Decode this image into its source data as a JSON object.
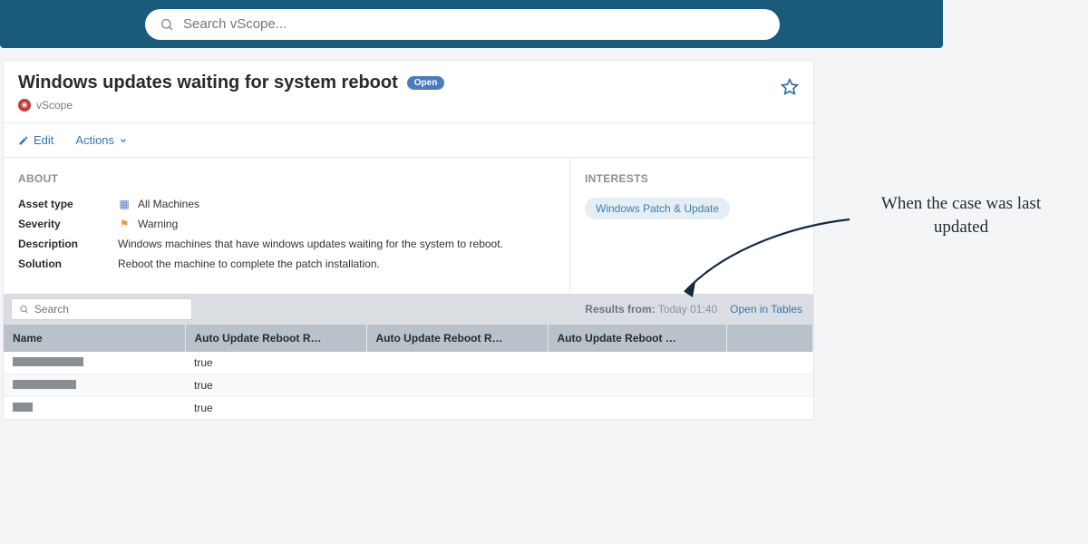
{
  "search": {
    "placeholder": "Search vScope..."
  },
  "header": {
    "title": "Windows updates waiting for system reboot",
    "badge": "Open",
    "org": "vScope"
  },
  "actions": {
    "edit": "Edit",
    "actions": "Actions"
  },
  "about": {
    "heading": "ABOUT",
    "assetType_label": "Asset type",
    "assetType_value": "All Machines",
    "severity_label": "Severity",
    "severity_value": "Warning",
    "description_label": "Description",
    "description_value": "Windows machines that have windows updates waiting for the system to reboot.",
    "solution_label": "Solution",
    "solution_value": "Reboot the machine to complete the patch installation."
  },
  "interests": {
    "heading": "INTERESTS",
    "pill": "Windows Patch & Update"
  },
  "results": {
    "search_placeholder": "Search",
    "from_label": "Results from:",
    "from_value": "Today 01:40",
    "open_link": "Open in Tables"
  },
  "table": {
    "cols": [
      "Name",
      "Auto Update Reboot R…",
      "Auto Update Reboot R…",
      "Auto Update Reboot …",
      ""
    ],
    "rows": [
      {
        "c1": "true"
      },
      {
        "c1": "true"
      },
      {
        "c1": "true"
      }
    ]
  },
  "annotation": "When the case was last updated"
}
